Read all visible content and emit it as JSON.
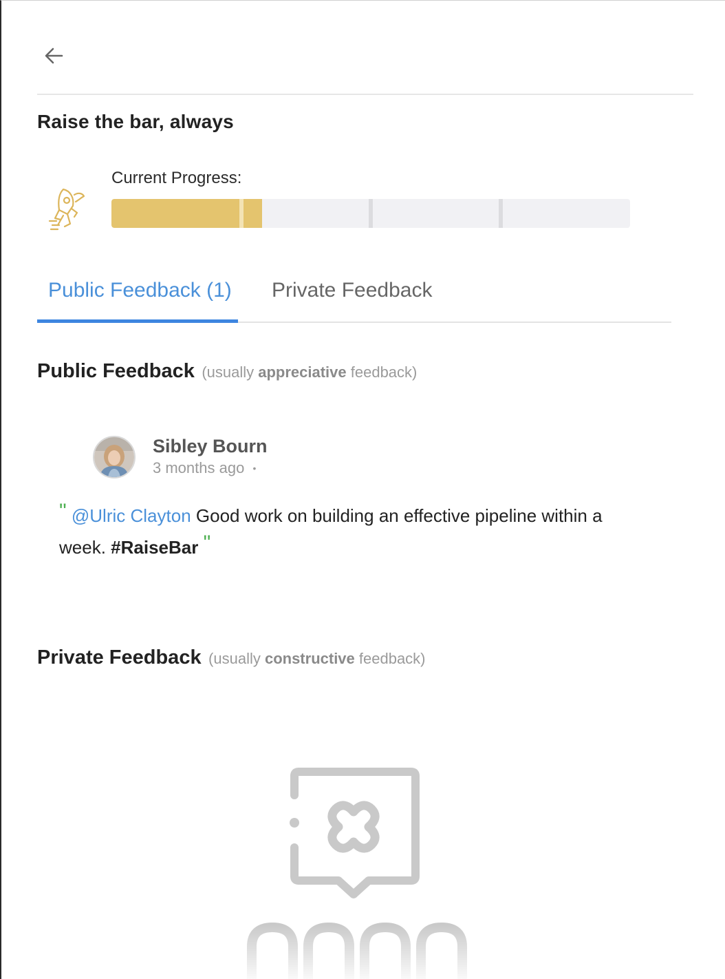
{
  "header": {
    "back_icon": "arrow-left-icon",
    "title": "Raise the bar, always"
  },
  "progress": {
    "label": "Current Progress:",
    "icon": "rocket-icon",
    "fill_fraction": 0.29,
    "segments": 4,
    "fill_color": "#e4c46e",
    "track_color": "#f1f1f4"
  },
  "tabs": [
    {
      "label": "Public Feedback (1)",
      "active": true
    },
    {
      "label": "Private Feedback",
      "active": false
    }
  ],
  "accent_color": "#3d85e0",
  "public_section": {
    "heading": "Public Feedback",
    "sub_prefix": "(usually ",
    "sub_bold": "appreciative",
    "sub_suffix": " feedback)"
  },
  "feedback_item": {
    "author": "Sibley Bourn",
    "time": "3 months ago",
    "dot": "•",
    "open_quote": "\"",
    "mention": "@Ulric Clayton",
    "text": " Good work on building an effective pipeline within a week. ",
    "hashtag": "#RaiseBar",
    "close_quote": "\""
  },
  "private_section": {
    "heading": "Private Feedback",
    "sub_prefix": "(usually ",
    "sub_bold": "constructive",
    "sub_suffix": " feedback)",
    "empty_icon": "no-feedback-icon"
  }
}
